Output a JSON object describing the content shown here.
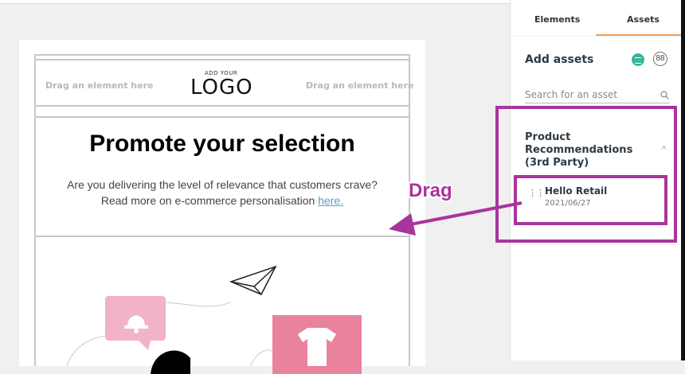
{
  "email": {
    "slot_left": "Drag an element here",
    "slot_right": "Drag an element here",
    "logo_small": "ADD YOUR",
    "logo_big": "LOGO",
    "headline": "Promote your selection",
    "body_line1": "Are you delivering the level of relevance that customers crave?",
    "body_line2_prefix": "Read more on e-commerce personalisation ",
    "body_link": "here."
  },
  "panel": {
    "tabs": [
      {
        "label": "Elements",
        "active": false
      },
      {
        "label": "Assets",
        "active": true
      }
    ],
    "add_assets_title": "Add assets",
    "search_placeholder": "Search for an asset",
    "section_title": "Product Recommendations (3rd Party)",
    "assets": [
      {
        "name": "Hello Retail",
        "date": "2021/06/27"
      }
    ]
  },
  "annotation": {
    "label": "Drag",
    "color": "#a8359c"
  },
  "icons": {
    "search": "search-icon",
    "chevron": "chevron-up-icon",
    "drag": "drag-handle-icon",
    "list_view": "list-view-icon",
    "grid_view": "grid-view-icon"
  },
  "colors": {
    "accent_tab": "#f0a060",
    "list_view_active": "#3cb49a",
    "link": "#4aa3c9"
  }
}
